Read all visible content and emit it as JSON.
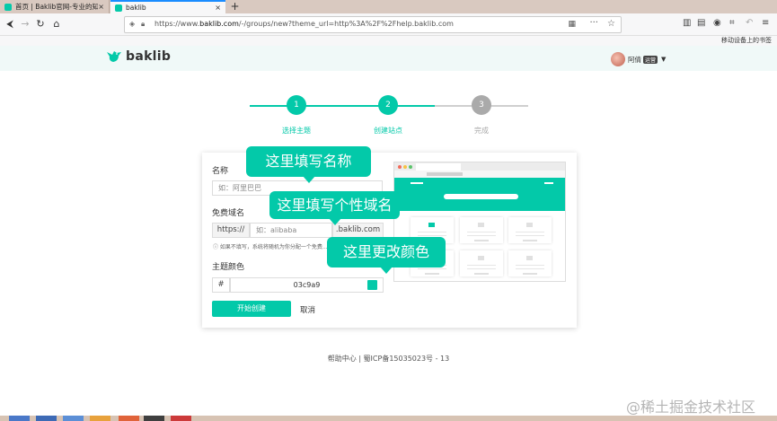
{
  "browser": {
    "tabs": [
      {
        "title": "首页 | Baklib官网-专业的知识...",
        "active": false
      },
      {
        "title": "baklib",
        "active": true
      }
    ],
    "new_tab": "+",
    "close_glyph": "×",
    "url": {
      "prefix": "https://www.",
      "host": "baklib.com",
      "path": "/-/groups/new?theme_url=http%3A%2F%2Fhelp.baklib.com"
    },
    "device_bar_label": "移动设备上的书签"
  },
  "site": {
    "logo_text": "baklib",
    "user": {
      "name": "阿倩",
      "badge": "运营"
    }
  },
  "steps": [
    {
      "number": "1",
      "label": "选择主题",
      "state": "done"
    },
    {
      "number": "2",
      "label": "创建站点",
      "state": "current"
    },
    {
      "number": "3",
      "label": "完成",
      "state": "pending"
    }
  ],
  "form": {
    "name_label": "名称",
    "name_placeholder": "如：阿里巴巴",
    "domain_label": "免费域名",
    "domain_prefix": "https://",
    "domain_placeholder": "如：alibaba",
    "domain_suffix": ".baklib.com",
    "domain_hint": "如果不填写，系统将随机为你分配一个免费...",
    "color_label": "主题颜色",
    "color_prefix": "#",
    "color_value": "03c9a9",
    "submit_label": "开始创建",
    "cancel_label": "取消"
  },
  "annotations": {
    "name_tip": "这里填写名称",
    "domain_tip": "这里填写个性域名",
    "color_tip": "这里更改颜色"
  },
  "footer": {
    "text": "帮助中心 | 蜀ICP备15035023号 - 13"
  },
  "watermark": "@稀土掘金技术社区",
  "colors": {
    "accent": "#03c9a9",
    "pending": "#aaaaaa"
  }
}
